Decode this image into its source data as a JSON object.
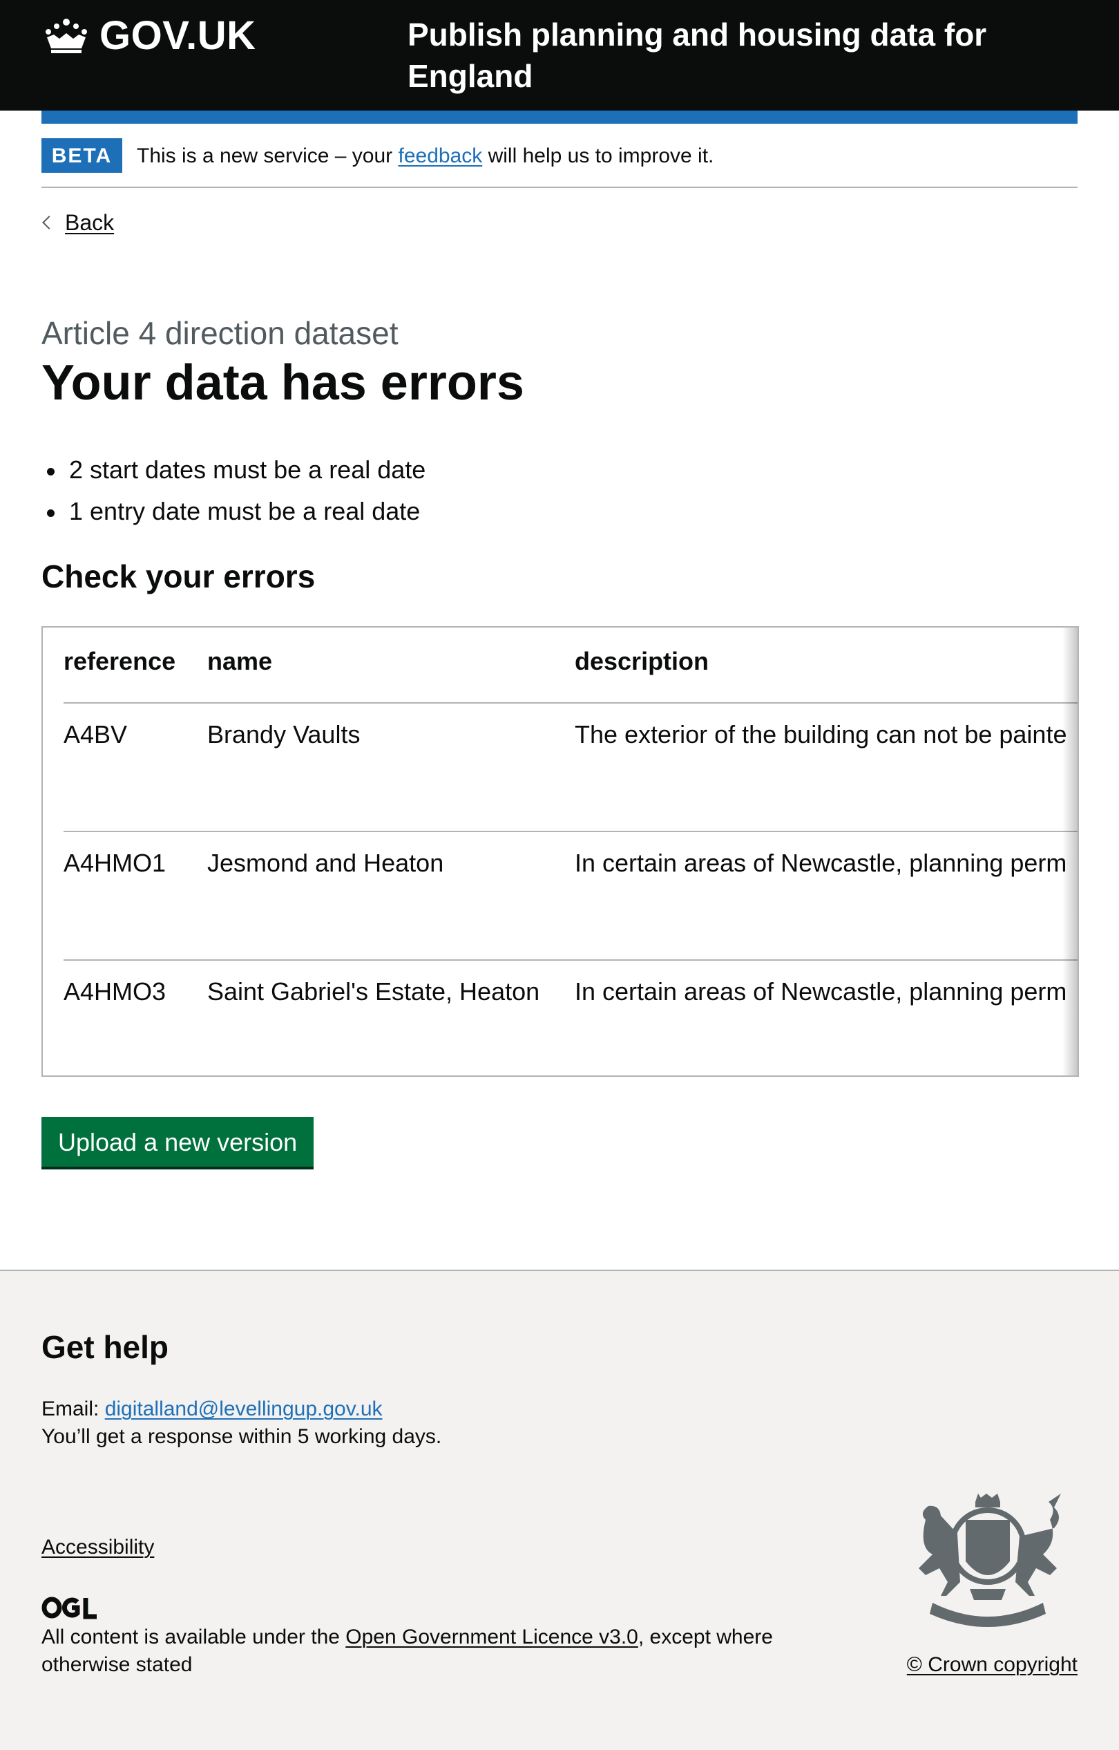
{
  "header": {
    "logo_text": "GOV.UK",
    "service_name": "Publish planning and housing data for England"
  },
  "phase_banner": {
    "tag": "BETA",
    "text_before": "This is a new service – your ",
    "link": "feedback",
    "text_after": " will help us to improve it."
  },
  "back_link": "Back",
  "caption": "Article 4 direction dataset",
  "title": "Your data has errors",
  "error_summary": [
    "2 start dates must be a real date",
    "1 entry date must be a real date"
  ],
  "check_heading": "Check your errors",
  "table": {
    "headers": [
      "reference",
      "name",
      "description"
    ],
    "rows": [
      [
        "A4BV",
        "Brandy Vaults",
        "The exterior of the building can not be painte"
      ],
      [
        "A4HMO1",
        "Jesmond and Heaton",
        "In certain areas of Newcastle, planning perm"
      ],
      [
        "A4HMO3",
        "Saint Gabriel's Estate, Heaton",
        "In certain areas of Newcastle, planning perm"
      ]
    ]
  },
  "upload_button": "Upload a new version",
  "footer": {
    "heading": "Get help",
    "email_label": "Email: ",
    "email": "digitalland@levellingup.gov.uk",
    "response_text": "You’ll get a response within 5 working days.",
    "accessibility_link": "Accessibility",
    "licence_before": "All content is available under the ",
    "licence_link": "Open Government Licence v3.0",
    "licence_after": ", except where otherwise stated",
    "copyright": "© Crown copyright"
  },
  "colors": {
    "header_bg": "#0b0c0c",
    "brand_blue": "#1d70b8",
    "button_green": "#00703c",
    "footer_bg": "#f3f2f1"
  }
}
